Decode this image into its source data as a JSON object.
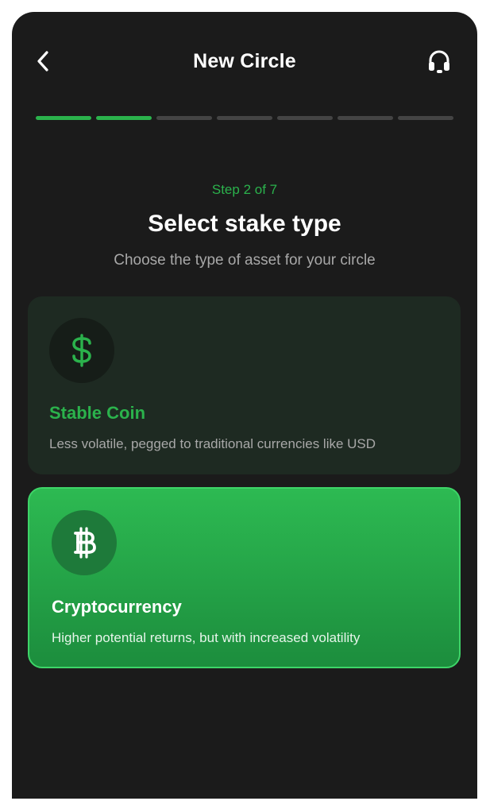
{
  "header": {
    "title": "New Circle",
    "back_icon": "chevron-left-icon",
    "support_icon": "headset-icon"
  },
  "progress": {
    "current_step": 2,
    "total_steps": 7,
    "active_color": "#2bb24c",
    "inactive_color": "#444444"
  },
  "intro": {
    "step_label": "Step 2 of 7",
    "heading": "Select stake type",
    "subheading": "Choose the type of asset for your circle"
  },
  "options": [
    {
      "title": "Stable Coin",
      "description": "Less volatile, pegged to traditional currencies like USD",
      "icon": "dollar-icon",
      "selected": false
    },
    {
      "title": "Cryptocurrency",
      "description": "Higher potential returns, but with increased volatility",
      "icon": "bitcoin-icon",
      "selected": true
    }
  ],
  "colors": {
    "accent": "#2bb24c",
    "background": "#1b1b1b",
    "selected_card": "#2dba52"
  }
}
